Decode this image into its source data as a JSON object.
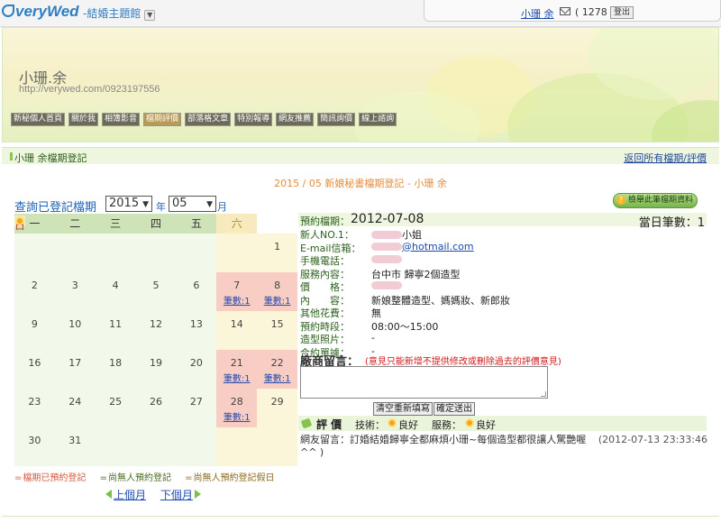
{
  "header": {
    "logo": "veryWed",
    "theme_label": "-結婚主題館",
    "username": "小珊 余",
    "mail_count": "( 1278 )",
    "logout": "登出"
  },
  "banner": {
    "title": "小珊.余",
    "url": "http://verywed.com/0923197556"
  },
  "nav": [
    "新秘個人首頁",
    "關於我",
    "相簿影音",
    "檔期評價",
    "部落格文章",
    "特別報導",
    "網友推薦",
    "簡訊詢價",
    "線上諮詢"
  ],
  "titlebar": {
    "title": "小珊 余檔期登記",
    "back_link": "返回所有檔期/評價"
  },
  "center_heading": "2015 / 05 新娘秘書檔期登記 - 小珊 余",
  "query": {
    "label": "查詢已登記檔期",
    "year": "2015",
    "year_unit": "年",
    "month": "05",
    "month_unit": "月",
    "report_button": "檢舉此筆檔期資料"
  },
  "calendar": {
    "weekdays": [
      "一",
      "二",
      "三",
      "四",
      "五",
      "六",
      "日"
    ],
    "weeks": [
      [
        {
          "d": ""
        },
        {
          "d": ""
        },
        {
          "d": ""
        },
        {
          "d": ""
        },
        {
          "d": ""
        },
        {
          "d": ""
        },
        {
          "d": "1"
        }
      ],
      [
        {
          "d": "2"
        },
        {
          "d": "3"
        },
        {
          "d": "4"
        },
        {
          "d": "5"
        },
        {
          "d": "6"
        },
        {
          "d": "7",
          "count": "筆數:1"
        },
        {
          "d": "8",
          "count": "筆數:1"
        }
      ],
      [
        {
          "d": "9"
        },
        {
          "d": "10"
        },
        {
          "d": "11"
        },
        {
          "d": "12"
        },
        {
          "d": "13"
        },
        {
          "d": "14"
        },
        {
          "d": "15"
        }
      ],
      [
        {
          "d": "16"
        },
        {
          "d": "17"
        },
        {
          "d": "18"
        },
        {
          "d": "19"
        },
        {
          "d": "20"
        },
        {
          "d": "21",
          "count": "筆數:1"
        },
        {
          "d": "22",
          "count": "筆數:1"
        }
      ],
      [
        {
          "d": "23"
        },
        {
          "d": "24"
        },
        {
          "d": "25"
        },
        {
          "d": "26"
        },
        {
          "d": "27"
        },
        {
          "d": "28",
          "count": "筆數:1"
        },
        {
          "d": "29"
        }
      ],
      [
        {
          "d": "30"
        },
        {
          "d": "31"
        },
        {
          "d": ""
        },
        {
          "d": ""
        },
        {
          "d": ""
        },
        {
          "d": ""
        },
        {
          "d": ""
        }
      ]
    ],
    "legend_booked": "檔期已預約登記",
    "legend_free": "尚無人預約登記",
    "legend_holiday": "尚無人預約登記假日",
    "prev": "上個月",
    "next": "下個月",
    "colors": {
      "weekday": "#f2f8ea",
      "weekend": "#fbf6d9",
      "booked": "#f7cdc4"
    }
  },
  "detail": {
    "date_label": "預約檔期：",
    "date": "2012-07-08",
    "count_label": "當日筆數：",
    "count": "1",
    "rows": [
      {
        "k": "新人NO.1：",
        "v": "小姐",
        "blur": true
      },
      {
        "k": "E-mail信箱：",
        "v": "@hotmail.com",
        "blur": true,
        "link": true
      },
      {
        "k": "手機電話：",
        "v": "",
        "blur": true
      },
      {
        "k": "服務內容：",
        "v": "台中市 歸寧2個造型"
      },
      {
        "k": "價　　格：",
        "v": "",
        "blur": true
      },
      {
        "k": "內　　容：",
        "v": "新娘整體造型、媽媽妝、新郎妝"
      },
      {
        "k": "其他花費：",
        "v": "無"
      },
      {
        "k": "預約時段：",
        "v": "08:00～15:00"
      },
      {
        "k": "造型照片：",
        "v": "-"
      },
      {
        "k": "合約單據：",
        "v": "-"
      }
    ],
    "vendor_label": "廠商留言：",
    "vendor_warn": "(意見只能新增不提供修改或刪除過去的評價意見)",
    "clear_button": "清空重新填寫",
    "submit_button": "確定送出",
    "rating_title": "評 價",
    "tech_label": "技術：",
    "tech_value": "良好",
    "service_label": "服務：",
    "service_value": "良好",
    "review_text": "網友留言：訂婚結婚歸寧全都麻煩小珊~每個造型都很讓人驚艷喔^^ )",
    "review_time": "(2012-07-13 23:33:46"
  }
}
